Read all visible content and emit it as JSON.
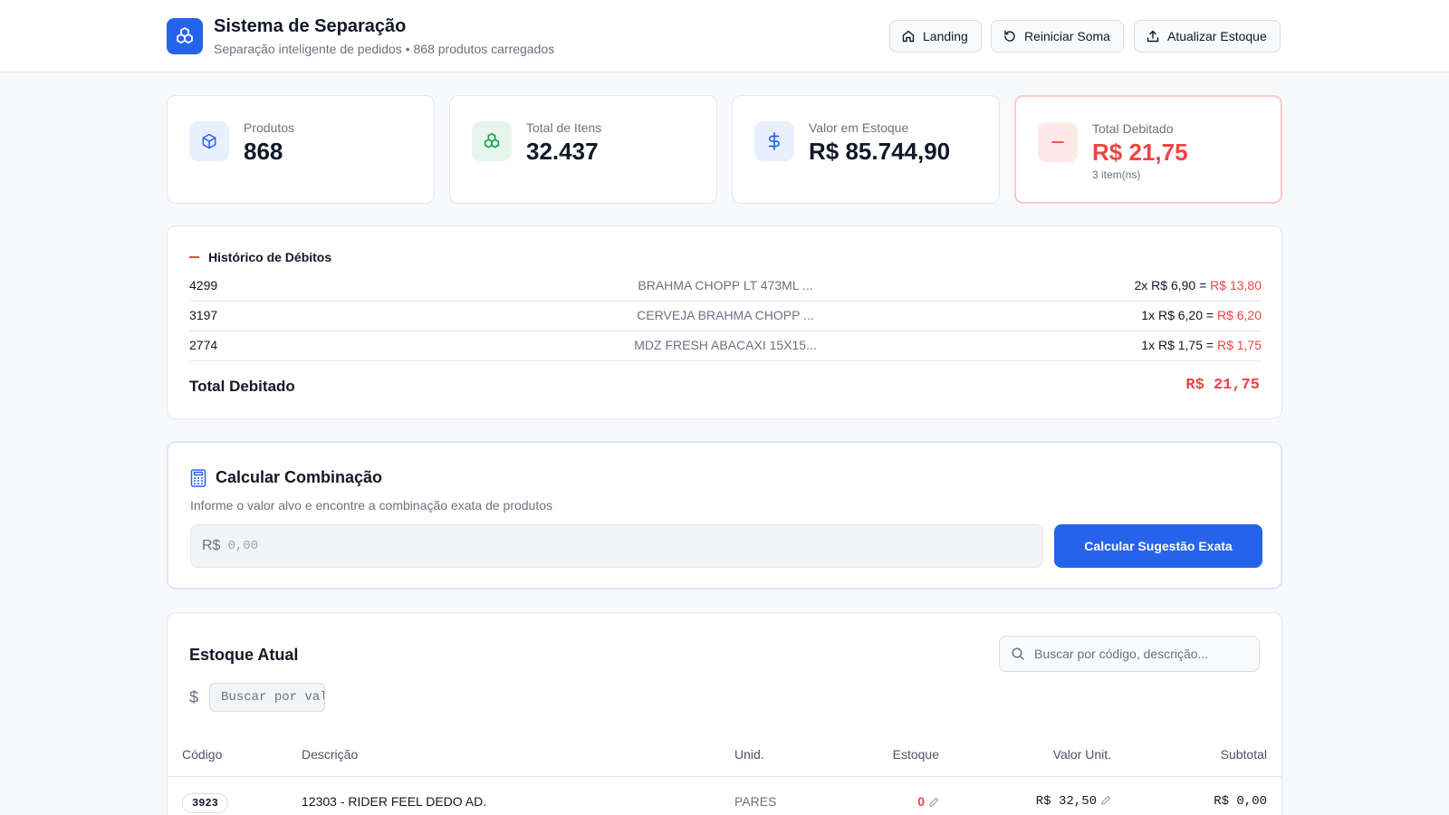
{
  "header": {
    "title": "Sistema de Separação",
    "subtitle": "Separação inteligente de pedidos • 868 produtos carregados",
    "buttons": {
      "landing": "Landing",
      "reset": "Reiniciar Soma",
      "update": "Atualizar Estoque"
    }
  },
  "stats": [
    {
      "label": "Produtos",
      "value": "868",
      "icon": "box-icon",
      "color": "#2563eb"
    },
    {
      "label": "Total de Itens",
      "value": "32.437",
      "icon": "boxes-icon",
      "color": "#16a34a"
    },
    {
      "label": "Valor em Estoque",
      "value": "R$ 85.744,90",
      "icon": "dollar-icon",
      "color": "#2563eb"
    },
    {
      "label": "Total Debitado",
      "value": "R$ 21,75",
      "note": "3 item(ns)",
      "icon": "minus-icon",
      "color": "#ef4444"
    }
  ],
  "history": {
    "title": "Histórico de Débitos",
    "rows": [
      {
        "code": "4299",
        "description": "BRAHMA CHOPP LT 473ML ...",
        "calc": "2x R$ 6,90 = ",
        "total": "R$ 13,80"
      },
      {
        "code": "3197",
        "description": "CERVEJA BRAHMA CHOPP ...",
        "calc": "1x R$ 6,20 = ",
        "total": "R$ 6,20"
      },
      {
        "code": "2774",
        "description": "MDZ FRESH ABACAXI 15X15...",
        "calc": "1x R$ 1,75 = ",
        "total": "R$ 1,75"
      }
    ],
    "total_label": "Total Debitado",
    "total_value": "R$ 21,75"
  },
  "calculator": {
    "title": "Calcular Combinação",
    "description": "Informe o valor alvo e encontre a combinação exata de produtos",
    "prefix": "R$",
    "placeholder": "0,00",
    "button": "Calcular Sugestão Exata"
  },
  "stock": {
    "title": "Estoque Atual",
    "search_placeholder": "Buscar por código, descrição...",
    "value_placeholder": "Buscar por valor",
    "dollar": "$",
    "columns": {
      "code": "Código",
      "description": "Descrição",
      "unit": "Unid.",
      "stock": "Estoque",
      "unit_value": "Valor Unit.",
      "subtotal": "Subtotal"
    },
    "rows": [
      {
        "code": "3923",
        "description": "12303 - RIDER FEEL DEDO AD.",
        "unit": "PARES",
        "stock": "0",
        "unit_value": "R$ 32,50",
        "subtotal": "R$ 0,00"
      }
    ]
  }
}
